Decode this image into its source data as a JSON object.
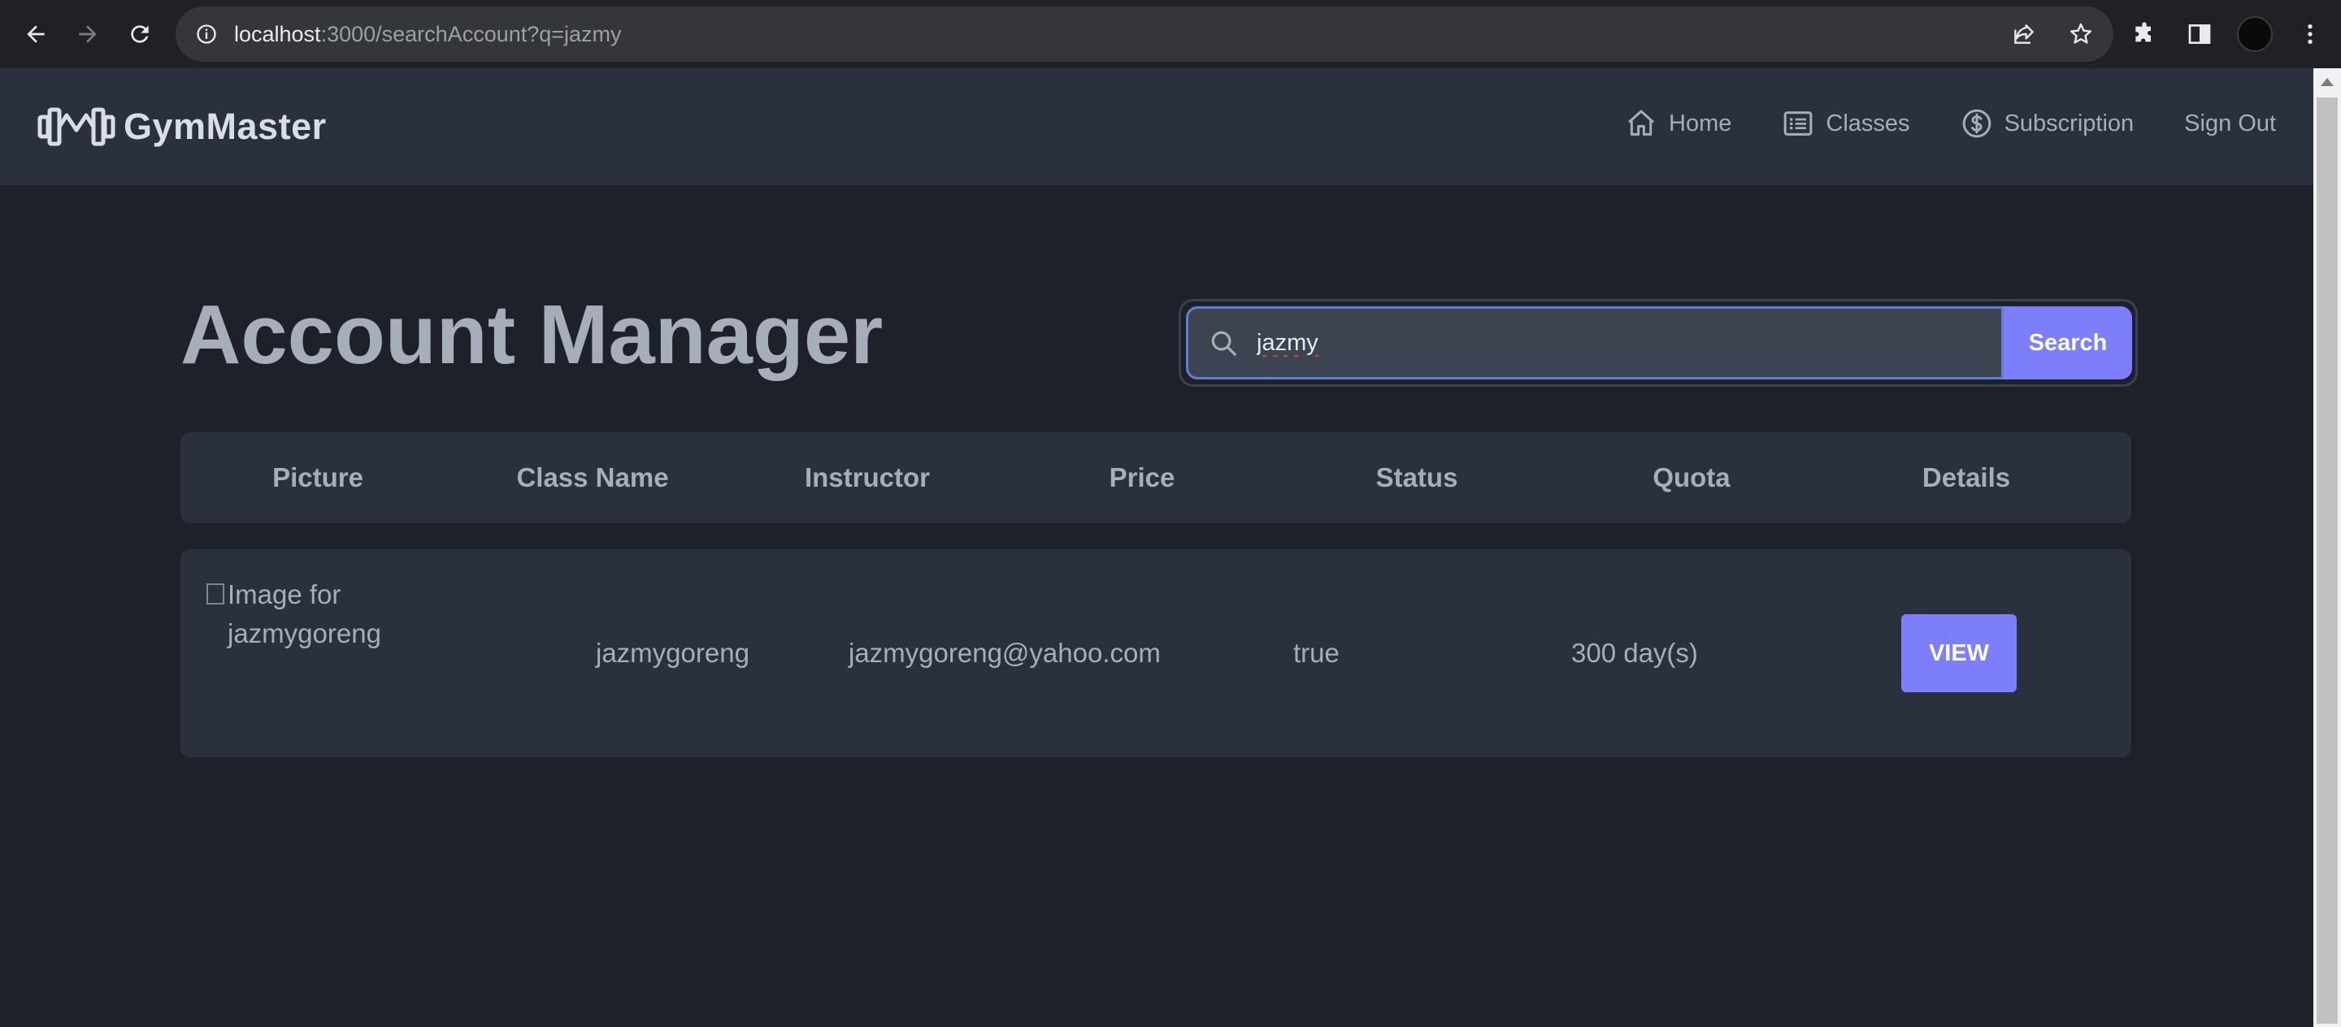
{
  "browser": {
    "url_host": "localhost",
    "url_path": ":3000/searchAccount?q=jazmy"
  },
  "app": {
    "brand": "GymMaster",
    "nav": [
      {
        "label": "Home",
        "icon": "home-icon"
      },
      {
        "label": "Classes",
        "icon": "list-icon"
      },
      {
        "label": "Subscription",
        "icon": "dollar-icon"
      },
      {
        "label": "Sign Out",
        "icon": ""
      }
    ]
  },
  "page": {
    "title": "Account Manager",
    "search": {
      "value": "jazmy",
      "button_label": "Search"
    }
  },
  "table": {
    "headers": [
      "Picture",
      "Class Name",
      "Instructor",
      "Price",
      "Status",
      "Quota",
      "Details"
    ],
    "rows": [
      {
        "picture_alt": "Image for jazmygoreng",
        "name": "jazmygoreng",
        "email": "jazmygoreng@yahoo.com",
        "status": "true",
        "quota": "300 day(s)",
        "action": "VIEW"
      }
    ]
  },
  "colors": {
    "background": "#1e212a",
    "surface": "#2a303c",
    "accent": "#7d7ef9",
    "text": "#a6adbb"
  }
}
